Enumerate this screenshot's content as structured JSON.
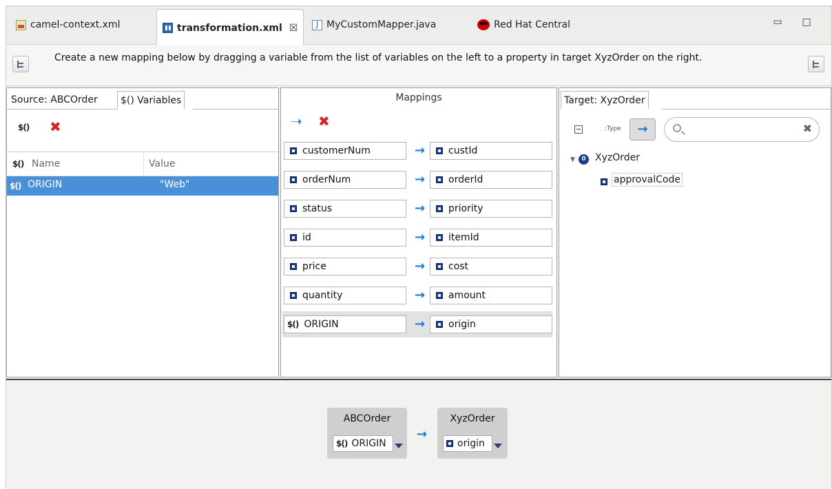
{
  "tabs": [
    {
      "label": "camel-context.xml",
      "icon": "xml-file-icon"
    },
    {
      "label": "transformation.xml",
      "icon": "mapping-file-icon",
      "close": "☒"
    },
    {
      "label": "MyCustomMapper.java",
      "icon": "java-file-icon",
      "glyph": "J"
    },
    {
      "label": "Red Hat Central",
      "icon": "redhat-icon"
    }
  ],
  "window": {
    "minimize": "▭",
    "maximize": "□"
  },
  "instructions": "Create a new mapping below by dragging a variable from the list of variables on the left to a property in target XyzOrder on the right.",
  "source_panel": {
    "tab_source": "Source: ABCOrder",
    "tab_variables": "$() Variables",
    "var_glyph": "$()",
    "delete_glyph": "✖",
    "columns": {
      "name": "Name",
      "value": "Value"
    },
    "rows": [
      {
        "name": "ORIGIN",
        "value": "\"Web\""
      }
    ]
  },
  "mappings_panel": {
    "title": "Mappings",
    "add_glyph": "➝",
    "delete_glyph": "✖",
    "rows": [
      {
        "source": "customerNum",
        "target": "custId",
        "source_var": false
      },
      {
        "source": "orderNum",
        "target": "orderId",
        "source_var": false
      },
      {
        "source": "status",
        "target": "priority",
        "source_var": false
      },
      {
        "source": "id",
        "target": "itemId",
        "source_var": false
      },
      {
        "source": "price",
        "target": "cost",
        "source_var": false
      },
      {
        "source": "quantity",
        "target": "amount",
        "source_var": false
      },
      {
        "source": "ORIGIN",
        "target": "origin",
        "source_var": true
      }
    ],
    "arrow": "→"
  },
  "target_panel": {
    "tab": "Target: XyzOrder",
    "type_glyph": ":Type",
    "search_placeholder": "",
    "clear_glyph": "✖",
    "root": "XyzOrder",
    "root_glyph": "0",
    "child": "approvalCode",
    "expand_glyph": "▼"
  },
  "details": {
    "source_title": "ABCOrder",
    "source_field": "ORIGIN",
    "target_title": "XyzOrder",
    "target_field": "origin",
    "arrow": "→"
  },
  "colors": {
    "selection": "#4a90d9",
    "arrow": "#1e78d8",
    "delete": "#d3232b"
  }
}
